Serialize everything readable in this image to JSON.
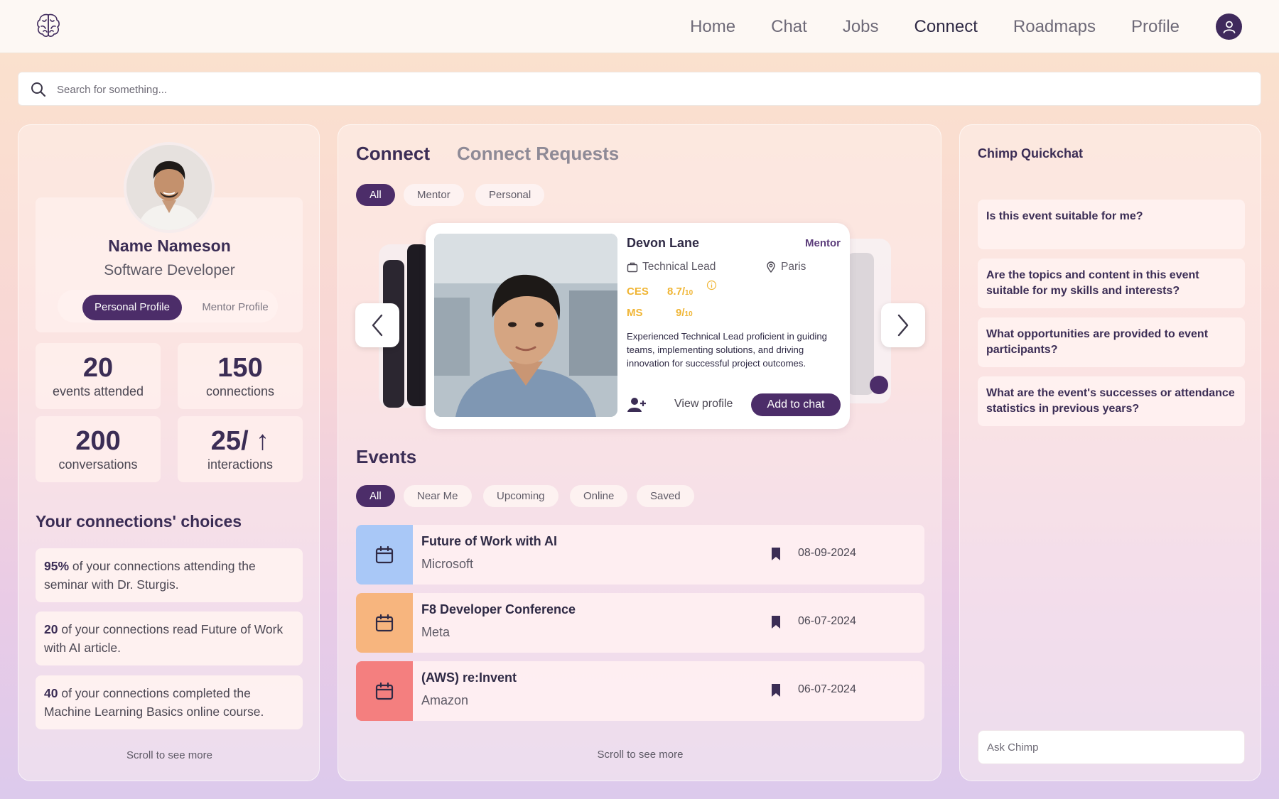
{
  "nav": {
    "links": [
      "Home",
      "Chat",
      "Jobs",
      "Connect",
      "Roadmaps",
      "Profile"
    ],
    "active": "Connect"
  },
  "search": {
    "placeholder": "Search for something..."
  },
  "profile": {
    "name": "Name Nameson",
    "role": "Software Developer",
    "toggle": {
      "personal": "Personal Profile",
      "mentor": "Mentor Profile"
    },
    "stats": [
      {
        "value": "20",
        "label": "events attended"
      },
      {
        "value": "150",
        "label": "connections"
      },
      {
        "value": "200",
        "label": "conversations"
      },
      {
        "value": "25/ ↑",
        "label": "interactions"
      }
    ]
  },
  "choices": {
    "title": "Your connections' choices",
    "items": [
      {
        "bold": "95%",
        "text": " of your connections attending the seminar with Dr. Sturgis."
      },
      {
        "bold": "20",
        "text": " of your connections read Future of Work with AI article."
      },
      {
        "bold": "40",
        "text": " of your connections completed the Machine Learning Basics online course."
      }
    ],
    "scroll": "Scroll to see more"
  },
  "connect": {
    "tabs": {
      "connect": "Connect",
      "requests": "Connect Requests"
    },
    "filters": [
      "All",
      "Mentor",
      "Personal"
    ],
    "card": {
      "name": "Devon Lane",
      "badge": "Mentor",
      "title": "Technical Lead",
      "location": "Paris",
      "ces_label": "CES",
      "ces_value": "8.7/",
      "ces_of": "10",
      "ms_label": "MS",
      "ms_value": "9/",
      "ms_of": "10",
      "bio": "Experienced Technical Lead proficient in guiding teams, implementing solutions, and driving innovation for successful project outcomes.",
      "view_profile": "View profile",
      "add_to_chat": "Add to chat"
    }
  },
  "events": {
    "title": "Events",
    "filters": [
      "All",
      "Near Me",
      "Upcoming",
      "Online",
      "Saved"
    ],
    "items": [
      {
        "title": "Future of Work with AI",
        "org": "Microsoft",
        "date": "08-09-2024",
        "color": "#a9c8f7"
      },
      {
        "title": "F8 Developer Conference",
        "org": "Meta",
        "date": "06-07-2024",
        "color": "#f7b57e"
      },
      {
        "title": "(AWS) re:Invent",
        "org": "Amazon",
        "date": "06-07-2024",
        "color": "#f47f7f"
      }
    ],
    "scroll": "Scroll to see more"
  },
  "quickchat": {
    "title": "Chimp Quickchat",
    "questions": [
      "Is this event suitable for me?",
      "Are the topics and content in this event suitable for my skills and interests?",
      "What opportunities are provided to event participants?",
      "What are the event's successes or attendance statistics in previous years?"
    ],
    "ask_placeholder": "Ask Chimp"
  },
  "colors": {
    "accent": "#4c2d69",
    "score": "#f0b534"
  }
}
